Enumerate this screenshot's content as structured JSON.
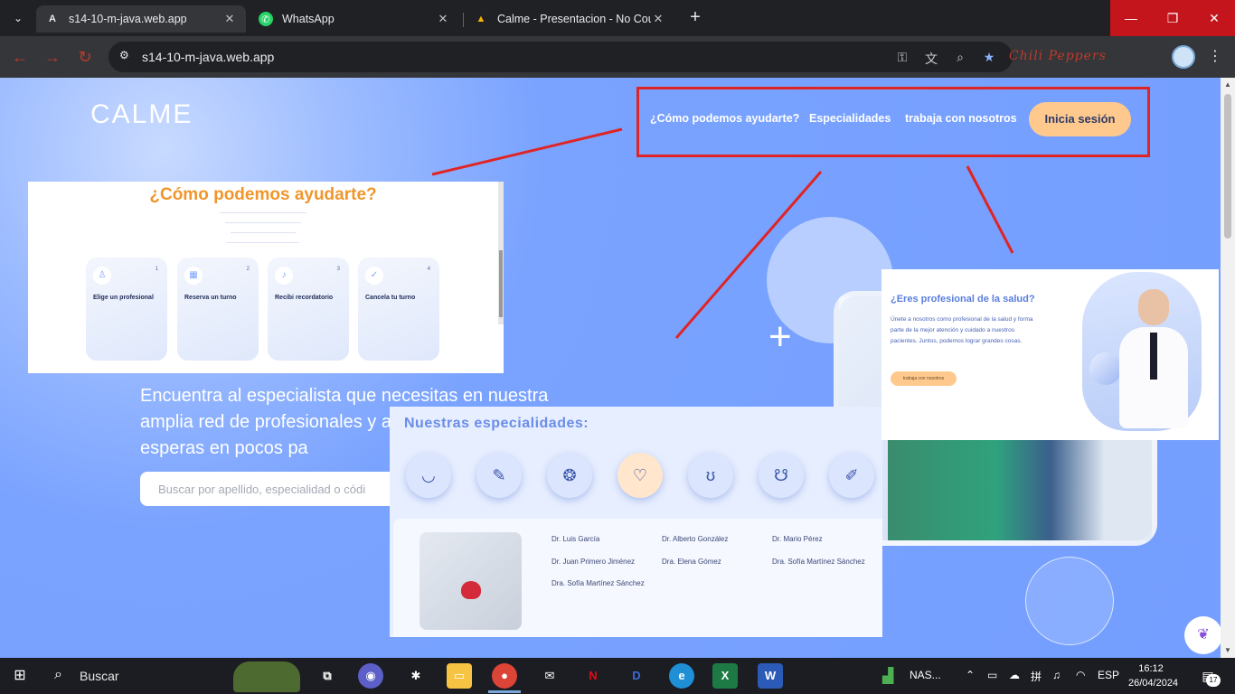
{
  "browser": {
    "tabs": [
      {
        "title": "s14-10-m-java.web.app",
        "favicon": "A"
      },
      {
        "title": "WhatsApp",
        "favicon": "whatsapp-icon"
      },
      {
        "title": "Calme - Presentacion - No Cou",
        "favicon": "drive-icon"
      }
    ],
    "url": "s14-10-m-java.web.app",
    "extension_label": "Chili Peppers"
  },
  "site": {
    "logo": "CALME",
    "nav": {
      "help": "¿Cómo podemos ayudarte?",
      "specialties": "Especialidades",
      "work": "trabaja con nosotros",
      "login": "Inicia sesión"
    },
    "hero_text": "Encuentra al especialista que necesitas en nuestra amplia red de profesionales y agenda tu cita sin esperas en pocos pa",
    "search_placeholder": "Buscar por apellido, especialidad o códi"
  },
  "overlay_help": {
    "title": "¿Cómo podemos ayudarte?",
    "cards": [
      {
        "title": "Elige un profesional",
        "num": "1"
      },
      {
        "title": "Reserva un turno",
        "num": "2"
      },
      {
        "title": "Recibi recordatorio",
        "num": "3"
      },
      {
        "title": "Cancela tu turno",
        "num": "4"
      }
    ]
  },
  "overlay_specialties": {
    "title": "Nuestras especialidades:",
    "icons": [
      "tooth-icon",
      "bone-icon",
      "brain-icon",
      "heartbeat-icon",
      "lungs-icon",
      "stomach-icon",
      "syringe-icon"
    ],
    "doctors": [
      "Dr. Luis García",
      "Dr. Alberto González",
      "Dr. Mario Pérez",
      "Dr. Juan Primero Jiménez",
      "Dra. Elena Gómez",
      "Dra. Sofía Martínez Sánchez",
      "Dra. Sofía Martínez Sánchez"
    ]
  },
  "overlay_pro": {
    "title": "¿Eres profesional de la salud?",
    "text": "Únete a nosotros como profesional de la salud y forma parte de la mejor atención y cuidado a nuestros pacientes. Juntos, podemos lograr grandes cosas.",
    "button": "trabaja con nosotros"
  },
  "taskbar": {
    "search": "Buscar",
    "nas_label": "NAS...",
    "language": "ESP",
    "time": "16:12",
    "date": "26/04/2024",
    "notifications": "17"
  },
  "colors": {
    "accent_orange": "#ffc98e",
    "page_blue": "#7aa3ff",
    "annotation_red": "#e02424",
    "help_title_orange": "#f0962a"
  }
}
